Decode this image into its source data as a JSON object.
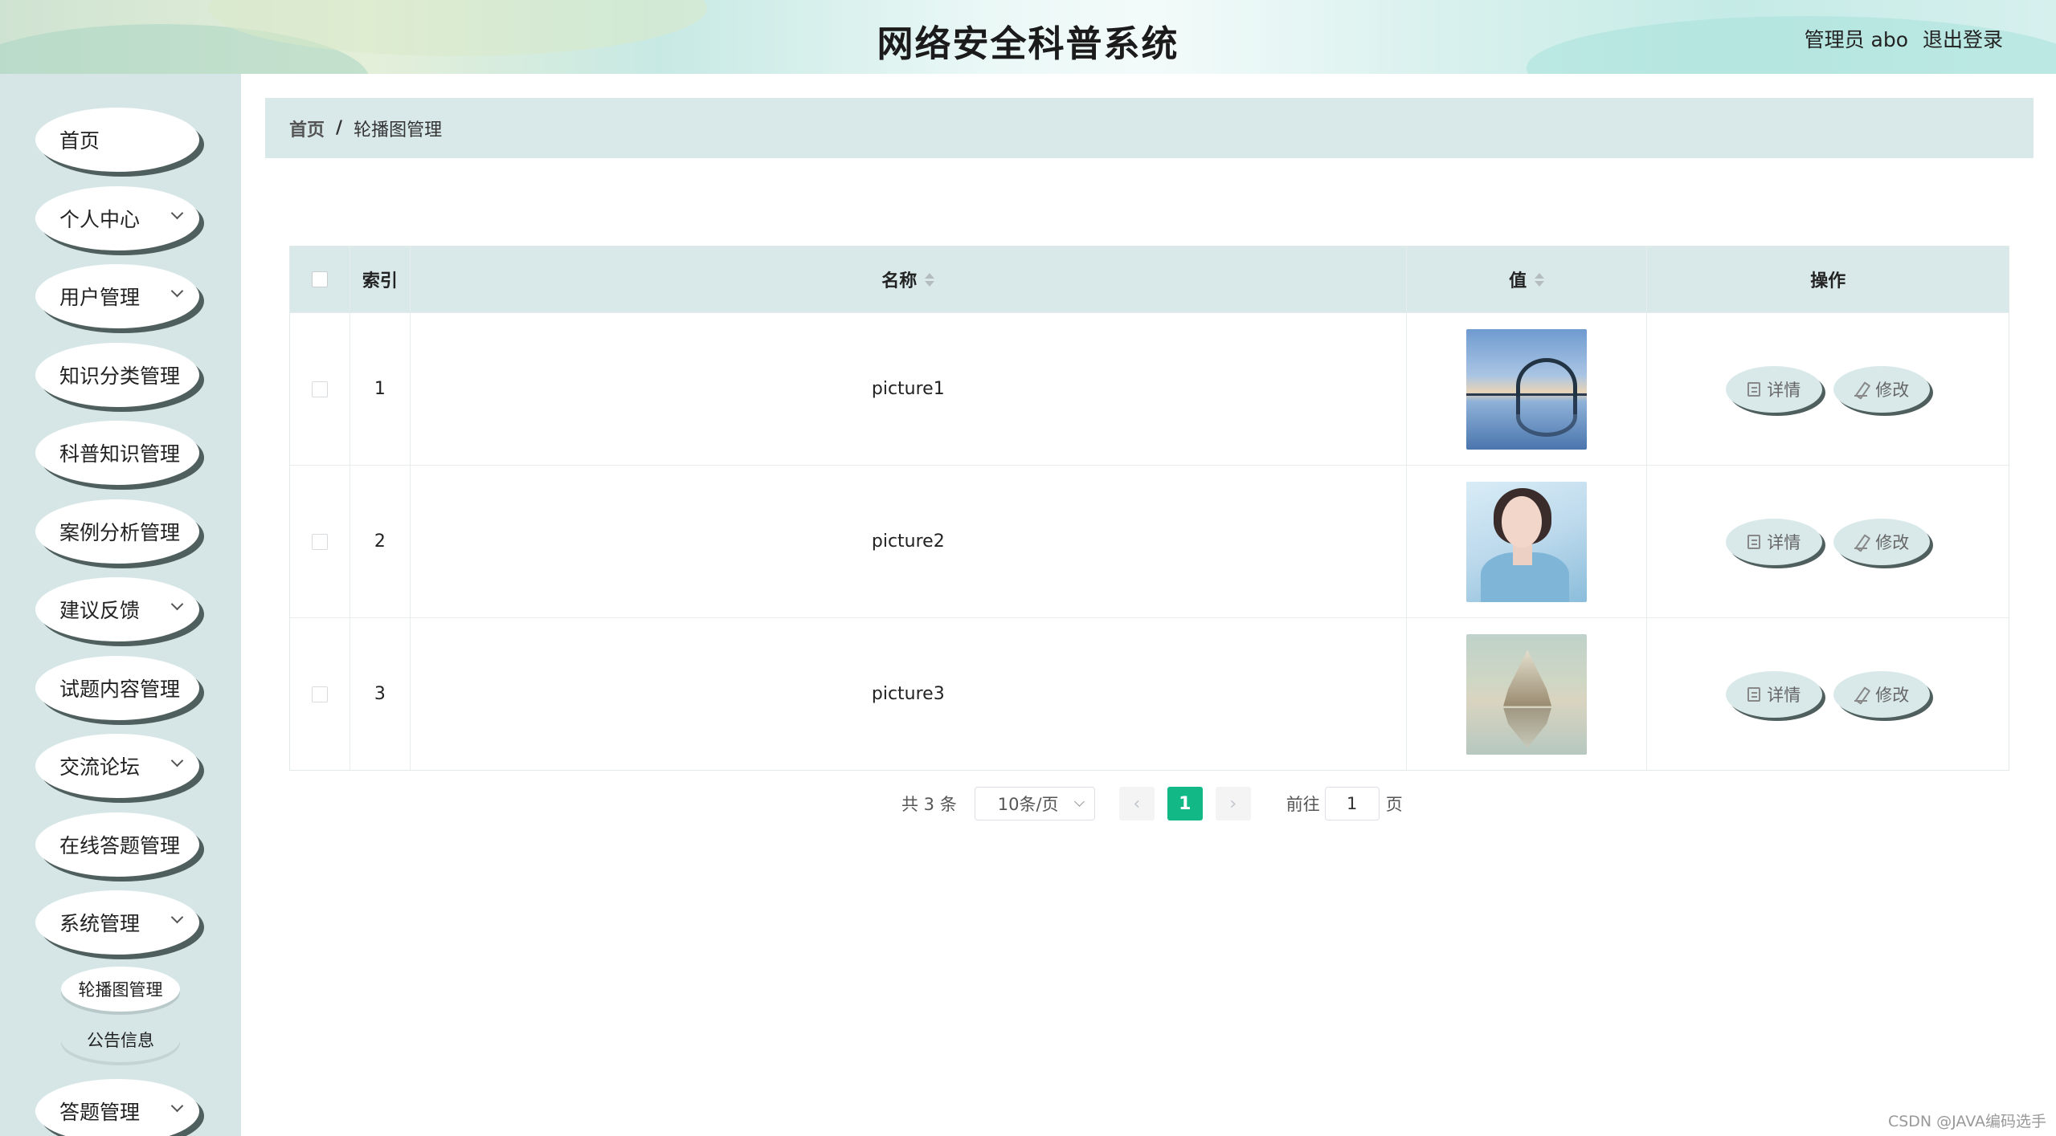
{
  "header": {
    "title": "网络安全科普系统",
    "user": "管理员 abo",
    "logout": "退出登录"
  },
  "sidebar": {
    "items": [
      {
        "label": "首页",
        "has_arrow": false
      },
      {
        "label": "个人中心",
        "has_arrow": true
      },
      {
        "label": "用户管理",
        "has_arrow": true
      },
      {
        "label": "知识分类管理",
        "has_arrow": true
      },
      {
        "label": "科普知识管理",
        "has_arrow": true
      },
      {
        "label": "案例分析管理",
        "has_arrow": true
      },
      {
        "label": "建议反馈",
        "has_arrow": true
      },
      {
        "label": "试题内容管理",
        "has_arrow": true
      },
      {
        "label": "交流论坛",
        "has_arrow": true
      },
      {
        "label": "在线答题管理",
        "has_arrow": true
      },
      {
        "label": "系统管理",
        "has_arrow": true
      },
      {
        "label": "答题管理",
        "has_arrow": true
      }
    ],
    "sub_items": [
      "轮播图管理",
      "公告信息"
    ]
  },
  "breadcrumb": {
    "home": "首页",
    "sep": "/",
    "current": "轮播图管理"
  },
  "table": {
    "columns": [
      "索引",
      "名称",
      "值",
      "操作"
    ],
    "rows": [
      {
        "index": "1",
        "name": "picture1",
        "image": "bridge-at-sunset"
      },
      {
        "index": "2",
        "name": "picture2",
        "image": "woman-portrait"
      },
      {
        "index": "3",
        "name": "picture3",
        "image": "sailing-ship-reflection"
      }
    ],
    "detail_label": "详情",
    "edit_label": "修改"
  },
  "pagination": {
    "total": "共 3 条",
    "page_size": "10条/页",
    "prev": "‹",
    "current": "1",
    "next": "›",
    "goto_label": "前往",
    "goto_value": "1",
    "page_suffix": "页"
  },
  "watermark": "CSDN @JAVA编码选手",
  "colors": {
    "accent": "#12b886",
    "sidebar_bg": "#d6e6e6",
    "header_row_bg": "#d9e9ea"
  }
}
